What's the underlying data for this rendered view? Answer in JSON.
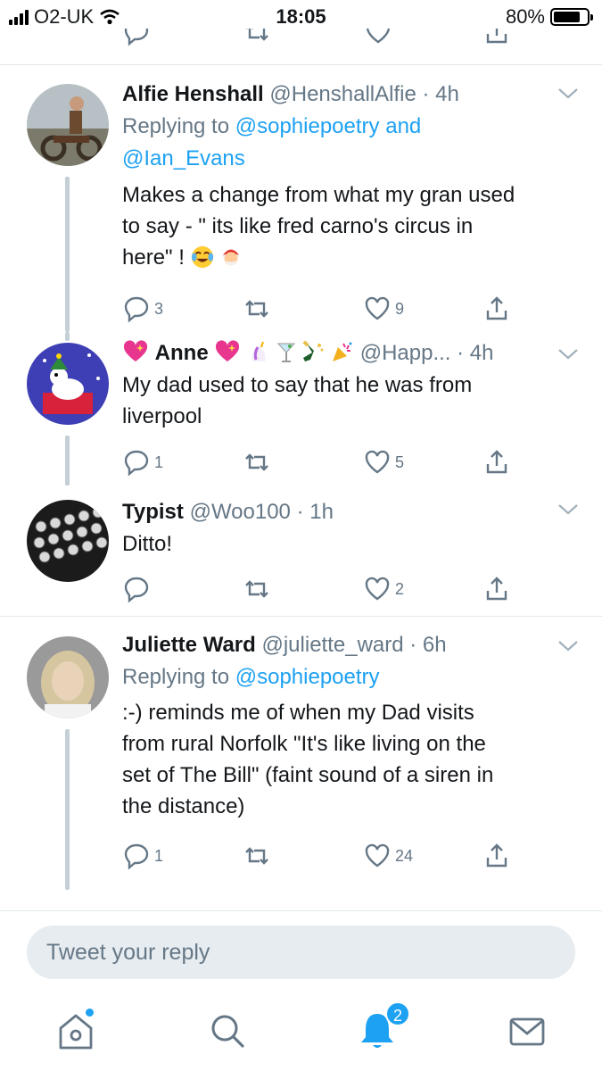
{
  "status_bar": {
    "carrier": "O2-UK",
    "time": "18:05",
    "battery": "80%",
    "battery_level": 0.8
  },
  "tweets": [
    {
      "name": "Alfie Henshall",
      "handle": "@HenshallAlfie",
      "time": "· 4h",
      "replying_prefix": "Replying to",
      "replying_to_1": "@sophiepoetry",
      "replying_joiner": "and",
      "replying_to_2": "@Ian_Evans",
      "text_lines": [
        "Makes a change from what my gran used",
        "to say - \" its like fred carno's circus in",
        "here\" !"
      ],
      "replies": "3",
      "retweets": "",
      "likes": "9"
    },
    {
      "name": "Anne",
      "handle": "@Happ...",
      "time": "· 4h",
      "text_lines": [
        "My dad used to say that he was from",
        "liverpool"
      ],
      "replies": "1",
      "retweets": "",
      "likes": "5"
    },
    {
      "name": "Typist",
      "handle": "@Woo100",
      "time": "· 1h",
      "text_lines": [
        "Ditto!"
      ],
      "replies": "",
      "retweets": "",
      "likes": "2"
    },
    {
      "name": "Juliette Ward",
      "handle": "@juliette_ward",
      "time": "· 6h",
      "replying_prefix": "Replying to",
      "replying_to_1": "@sophiepoetry",
      "text_lines": [
        ":-) reminds me of when my Dad visits",
        "from rural Norfolk \"It's like living on the",
        "set of The Bill\" (faint sound of a siren in",
        "the distance)"
      ],
      "replies": "1",
      "retweets": "",
      "likes": "24"
    }
  ],
  "reply_box": {
    "placeholder": "Tweet your reply"
  },
  "tab_bar": {
    "items": [
      "home-icon",
      "search-icon",
      "notifications-icon",
      "messages-icon"
    ],
    "notifications_badge": "2"
  },
  "colors": {
    "accent": "#1da1f2",
    "muted": "#657786",
    "divider": "#e1e8ed"
  }
}
